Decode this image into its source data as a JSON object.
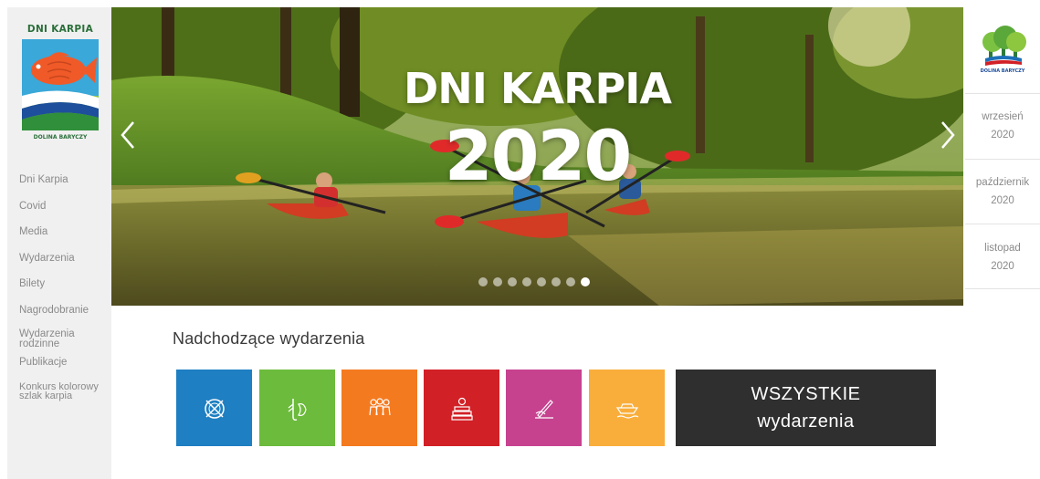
{
  "sidebar": {
    "logo": {
      "title": "DNI KARPIA",
      "subtitle": "DOLINA BARYCZY"
    },
    "nav_items": [
      {
        "label": "Dni Karpia"
      },
      {
        "label": "Covid"
      },
      {
        "label": "Media"
      },
      {
        "label": "Wydarzenia"
      },
      {
        "label": "Bilety"
      },
      {
        "label": "Nagrodobranie"
      },
      {
        "label": "Wydarzenia rodzinne"
      },
      {
        "label": "Publikacje"
      },
      {
        "label": "Konkurs kolorowy szlak karpia"
      }
    ]
  },
  "hero": {
    "title_line1": "DNI KARPIA",
    "title_line2": "2020",
    "slide_count": 8,
    "active_slide": 8
  },
  "brand": {
    "name": "DOLINA BARYCZY"
  },
  "dates": [
    {
      "month": "wrzesień",
      "year": "2020"
    },
    {
      "month": "październik",
      "year": "2020"
    },
    {
      "month": "listopad",
      "year": "2020"
    }
  ],
  "upcoming": {
    "title": "Nadchodzące wydarzenia",
    "categories": [
      {
        "icon": "plate-cutlery-icon",
        "color": "#1e7fc2"
      },
      {
        "icon": "fish-rod-icon",
        "color": "#6cbb3c"
      },
      {
        "icon": "people-group-icon",
        "color": "#f47a20"
      },
      {
        "icon": "books-apple-icon",
        "color": "#d22027"
      },
      {
        "icon": "hand-writing-icon",
        "color": "#c6428f"
      },
      {
        "icon": "boat-icon",
        "color": "#f9ae3b"
      }
    ],
    "all_button": {
      "line1": "WSZYSTKIE",
      "line2": "wydarzenia"
    }
  }
}
